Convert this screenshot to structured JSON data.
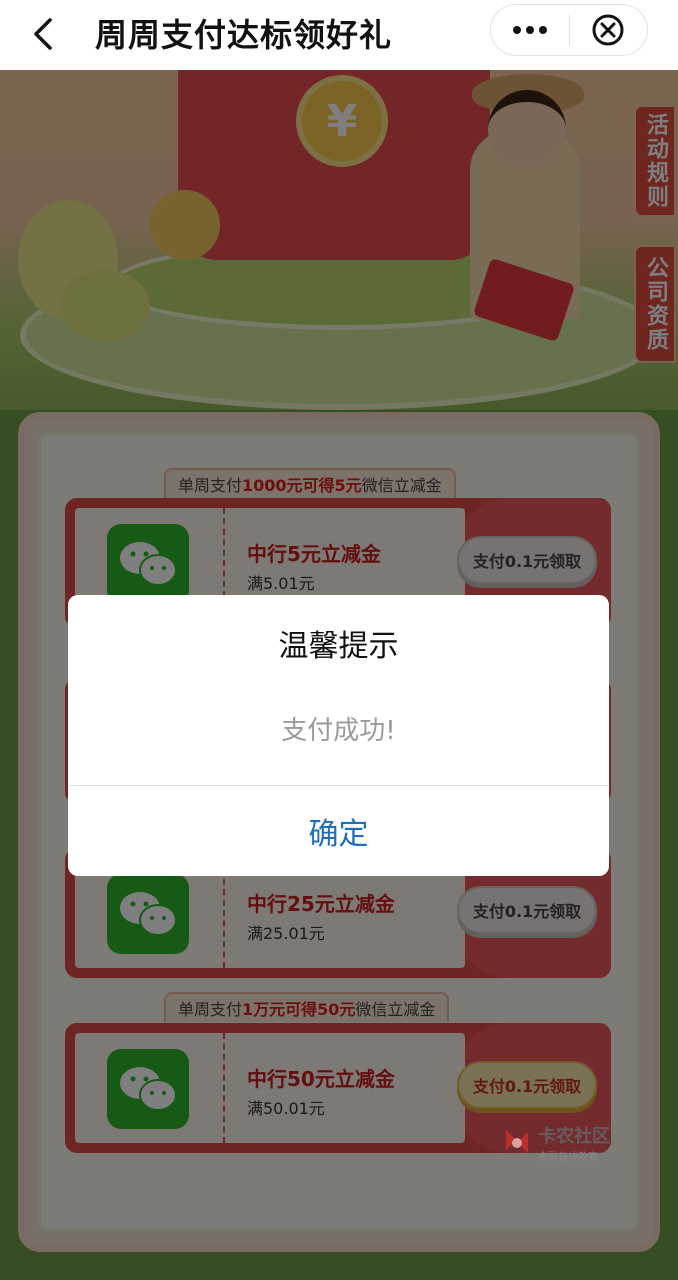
{
  "header": {
    "title": "周周支付达标领好礼",
    "more_icon": "more-dots-icon",
    "close_icon": "close-circle-icon",
    "back_icon": "back-arrow-icon"
  },
  "side_tabs": {
    "rules": "活动规则",
    "qualification": "公司资质"
  },
  "banner": {
    "coin_symbol": "¥"
  },
  "tiers": [
    {
      "label_prefix": "单周支付",
      "label_amount": "1000元可得5元",
      "label_suffix": "微信立减金",
      "coupon": {
        "name": "中行5元立减金",
        "condition": "满5.01元",
        "button": "支付0.1元领取"
      }
    },
    {
      "coupon": {
        "name": "中行25元立减金",
        "condition": "满25.01元",
        "button": "支付0.1元领取"
      }
    },
    {
      "label_prefix": "单周支付",
      "label_amount": "1万元可得50元",
      "label_suffix": "微信立减金",
      "coupon": {
        "name": "中行50元立减金",
        "condition": "满50.01元",
        "button": "支付0.1元领取"
      }
    }
  ],
  "watermark": {
    "main": "卡农社区",
    "sub": "金融在线教育"
  },
  "dialog": {
    "title": "温馨提示",
    "message": "支付成功!",
    "confirm": "确定"
  },
  "colors": {
    "accent_red": "#e04b4b",
    "wechat_green": "#2db42d",
    "confirm_blue": "#1f6fbd"
  }
}
